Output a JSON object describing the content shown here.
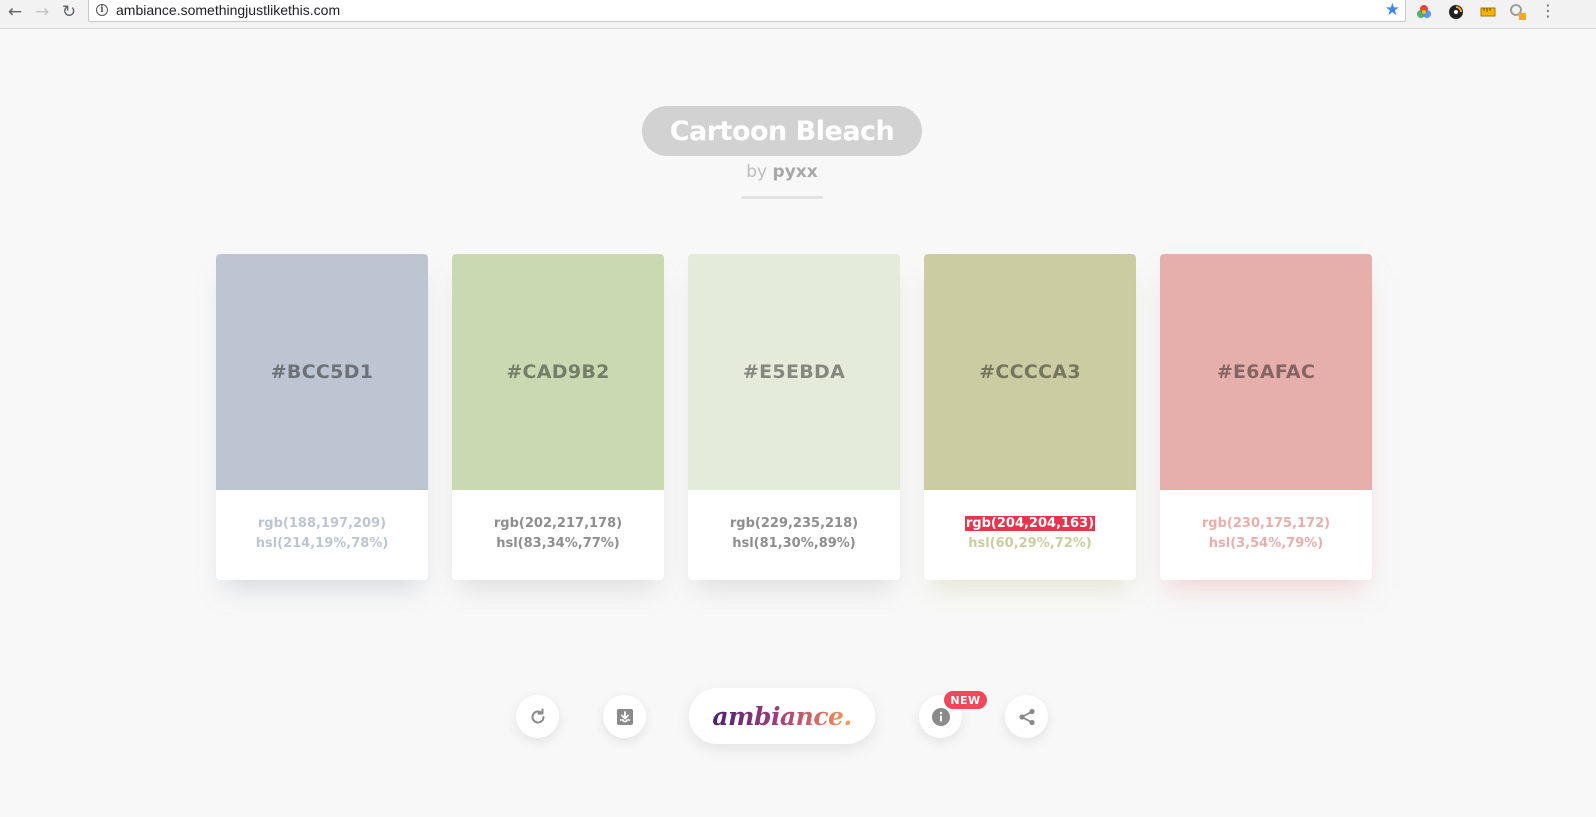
{
  "browser": {
    "url": "ambiance.somethingjustlikethis.com"
  },
  "palette": {
    "title": "Cartoon Bleach",
    "by_prefix": "by",
    "author": "pyxx"
  },
  "colors": [
    {
      "hex": "#BCC5D1",
      "rgb": "rgb(188,197,209)",
      "hsl": "hsl(214,19%,78%)",
      "swatch": "#bcc5d1",
      "text_color": "#bcc5d1",
      "shadow": "rgba(150,160,180,0.35)"
    },
    {
      "hex": "#CAD9B2",
      "rgb": "rgb(202,217,178)",
      "hsl": "hsl(83,34%,77%)",
      "swatch": "#cad9b2",
      "text_color": "#8e8e8e",
      "shadow": "rgba(150,150,150,0.28)"
    },
    {
      "hex": "#E5EBDA",
      "rgb": "rgb(229,235,218)",
      "hsl": "hsl(81,30%,89%)",
      "swatch": "#e5ebda",
      "text_color": "#8e8e8e",
      "shadow": "rgba(150,150,150,0.28)"
    },
    {
      "hex": "#CCCCA3",
      "rgb": "rgb(204,204,163)",
      "hsl": "hsl(60,29%,72%)",
      "swatch": "#cccca3",
      "text_color": "#cccca3",
      "shadow": "rgba(204,204,163,0.45)",
      "rgb_selected": true
    },
    {
      "hex": "#E6AFAC",
      "rgb": "rgb(230,175,172)",
      "hsl": "hsl(3,54%,79%)",
      "swatch": "#e6afac",
      "text_color": "#e6afac",
      "shadow": "rgba(230,175,172,0.5)"
    }
  ],
  "controls": {
    "logo": "ambiance.",
    "new_badge": "NEW"
  }
}
